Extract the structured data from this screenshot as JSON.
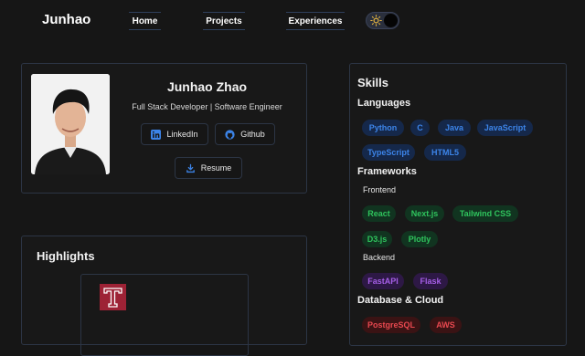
{
  "nav": {
    "brand": "Junhao",
    "items": [
      "Home",
      "Projects",
      "Experiences"
    ]
  },
  "profile": {
    "name": "Junhao Zhao",
    "role": "Full Stack Developer | Software Engineer",
    "buttons": {
      "linkedin": "LinkedIn",
      "github": "Github",
      "resume": "Resume"
    }
  },
  "highlights": {
    "title": "Highlights"
  },
  "skills": {
    "title": "Skills",
    "languages": {
      "title": "Languages",
      "items": [
        "Python",
        "C",
        "Java",
        "JavaScript",
        "TypeScript",
        "HTML5"
      ]
    },
    "frameworks": {
      "title": "Frameworks",
      "frontend_label": "Frontend",
      "frontend": [
        "React",
        "Next.js",
        "Tailwind CSS",
        "D3.js",
        "Plotly"
      ],
      "backend_label": "Backend",
      "backend": [
        "FastAPI",
        "Flask"
      ]
    },
    "database": {
      "title": "Database & Cloud",
      "items": [
        "PostgreSQL",
        "AWS"
      ]
    }
  },
  "colors": {
    "background": "#161616",
    "blue": "#3c84e8",
    "green": "#2fc45d",
    "purple": "#a65fe8",
    "red": "#e8484f"
  }
}
